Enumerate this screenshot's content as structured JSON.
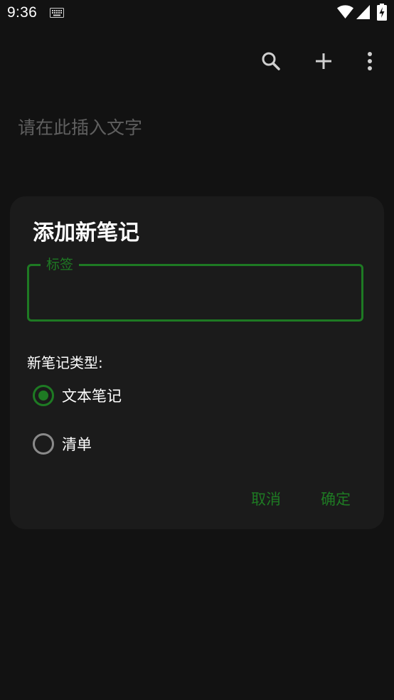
{
  "status_bar": {
    "time": "9:36",
    "icons": [
      "keyboard-icon",
      "wifi-icon",
      "signal-icon",
      "battery-charging-icon"
    ]
  },
  "toolbar": {
    "icons": [
      "search-icon",
      "add-icon",
      "more-vert-icon"
    ]
  },
  "main": {
    "placeholder": "请在此插入文字"
  },
  "dialog": {
    "title": "添加新笔记",
    "field_label": "标签",
    "field_value": "",
    "type_label": "新笔记类型:",
    "options": [
      {
        "label": "文本笔记",
        "checked": true
      },
      {
        "label": "清单",
        "checked": false
      }
    ],
    "cancel_label": "取消",
    "ok_label": "确定"
  },
  "colors": {
    "background": "#121212",
    "dialog": "#1b1b1b",
    "accent": "#1e7a23"
  }
}
